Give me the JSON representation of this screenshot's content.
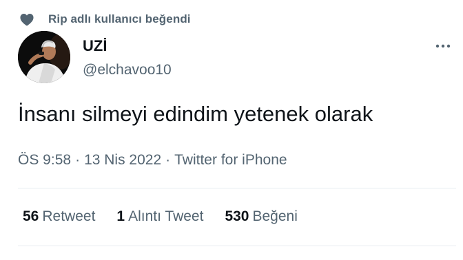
{
  "social_context": {
    "icon": "heart-icon",
    "text": "Rip adlı kullanıcı beğendi"
  },
  "author": {
    "display_name": "UZİ",
    "handle": "@elchavoo10"
  },
  "more_icon": "more-dots-icon",
  "tweet": {
    "text": "İnsanı silmeyi edindim yetenek olarak",
    "time": "ÖS 9:58",
    "date": "13 Nis 2022",
    "source": "Twitter for iPhone",
    "separator": "·"
  },
  "stats": {
    "retweets": {
      "count": "56",
      "label": "Retweet"
    },
    "quotes": {
      "count": "1",
      "label": "Alıntı Tweet"
    },
    "likes": {
      "count": "530",
      "label": "Beğeni"
    }
  },
  "colors": {
    "text_primary": "#0f1419",
    "text_secondary": "#536471",
    "divider": "#e6ecf0"
  }
}
